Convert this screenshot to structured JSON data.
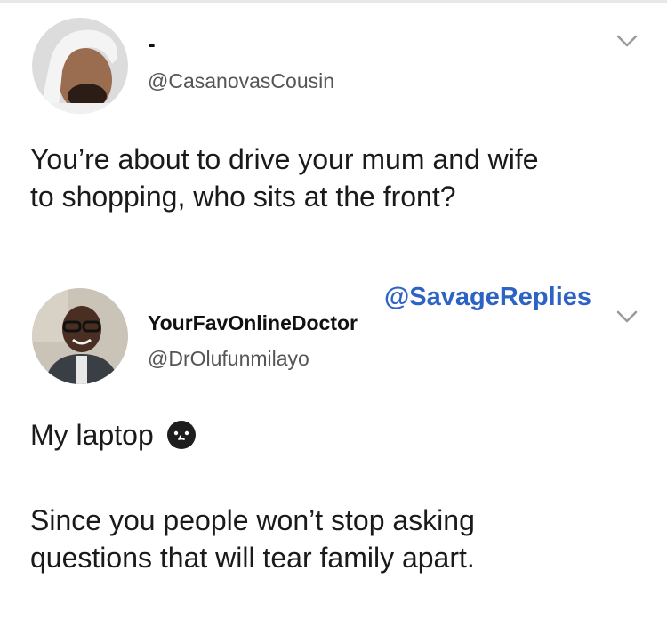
{
  "tweet1": {
    "display_name": "-",
    "handle": "@CasanovasCousin",
    "text_line1": "You’re about to drive your mum and wife",
    "text_line2": "to shopping, who sits at the front?"
  },
  "tweet2": {
    "display_name": "YourFavOnlineDoctor",
    "handle": "@DrOlufunmilayo",
    "text_line1": "My laptop",
    "text_para2_line1": "Since you people won’t stop asking",
    "text_para2_line2": "questions that will tear family apart."
  },
  "watermark": "@SavageReplies",
  "icons": {
    "menu": "chevron-down-icon",
    "emoji": "face-emoji-icon"
  },
  "colors": {
    "watermark": "#2d63c4",
    "text": "#1a1a1a",
    "handle": "#555555"
  }
}
